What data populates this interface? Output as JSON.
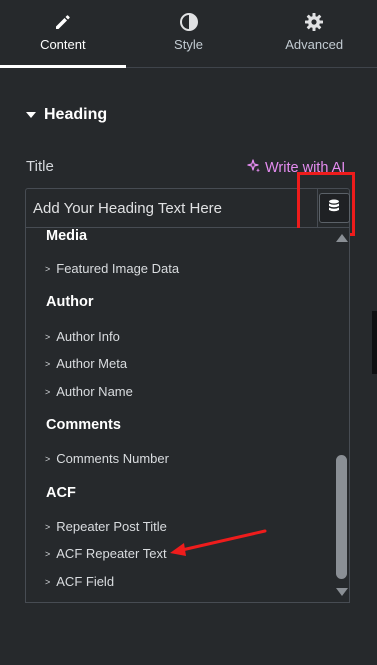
{
  "tabs": [
    {
      "label": "Content",
      "icon": "pencil-icon",
      "active": true
    },
    {
      "label": "Style",
      "icon": "half-circle-icon",
      "active": false
    },
    {
      "label": "Advanced",
      "icon": "gear-icon",
      "active": false
    }
  ],
  "section": {
    "title": "Heading"
  },
  "field": {
    "label": "Title",
    "ai_button": "Write with AI",
    "placeholder": "Add Your Heading Text Here",
    "value": ""
  },
  "dropdown": {
    "groups": [
      {
        "title": "Media",
        "items": [
          "Featured Image Data"
        ]
      },
      {
        "title": "Author",
        "items": [
          "Author Info",
          "Author Meta",
          "Author Name"
        ]
      },
      {
        "title": "Comments",
        "items": [
          "Comments Number"
        ]
      },
      {
        "title": "ACF",
        "items": [
          "Repeater Post Title",
          "ACF Repeater Text",
          "ACF Field"
        ]
      }
    ]
  },
  "colors": {
    "background": "#26292c",
    "ai_accent": "#e48cf0",
    "annotation": "#ee1c1c"
  }
}
